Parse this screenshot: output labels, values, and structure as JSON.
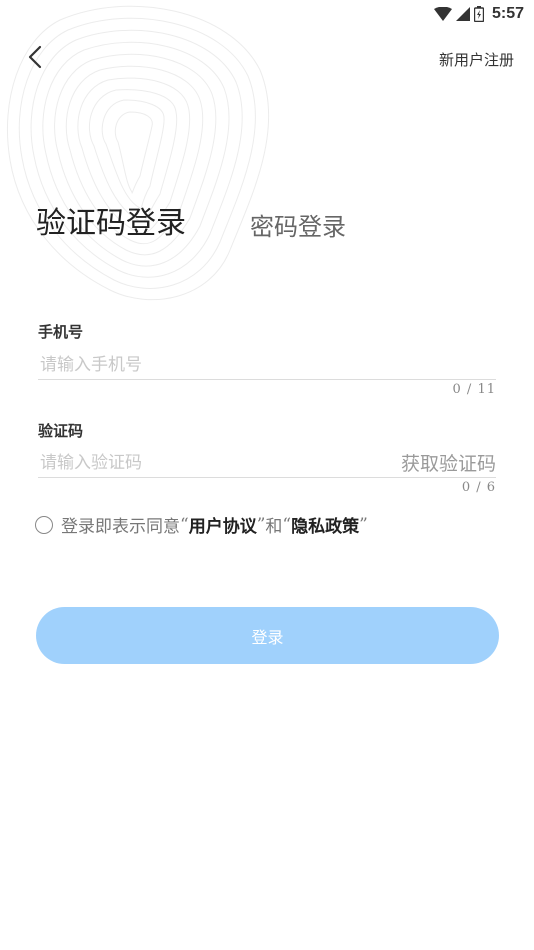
{
  "status_bar": {
    "time": "5:57",
    "icons": [
      "wifi-icon",
      "signal-icon",
      "battery-icon"
    ]
  },
  "header": {
    "back_icon": "chevron-left-icon",
    "register_label": "新用户注册"
  },
  "tabs": {
    "active_label": "验证码登录",
    "inactive_label": "密码登录"
  },
  "phone_field": {
    "label": "手机号",
    "placeholder": "请输入手机号",
    "value": "",
    "counter": "0 / 11"
  },
  "code_field": {
    "label": "验证码",
    "placeholder": "请输入验证码",
    "value": "",
    "get_code_label": "获取验证码",
    "counter": "0 / 6"
  },
  "agreement": {
    "prefix": "登录即表示同意",
    "quote_open_1": "“",
    "user_agreement": "用户协议",
    "quote_close_1": "”",
    "conjunction": "和",
    "quote_open_2": "“",
    "privacy_policy": "隐私政策",
    "quote_close_2": "”",
    "checked": false
  },
  "login_button": {
    "label": "登录"
  },
  "colors": {
    "accent_button": "#a0d1fc",
    "text_primary": "#222222",
    "text_placeholder": "#c8c8c8"
  }
}
